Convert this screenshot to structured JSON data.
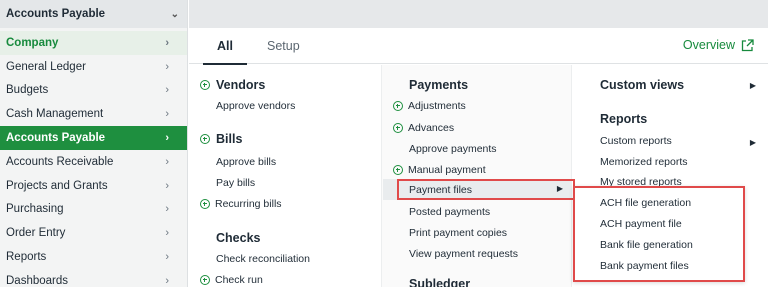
{
  "sidebar": {
    "header": "Accounts Payable",
    "items": [
      {
        "label": "Company"
      },
      {
        "label": "General Ledger"
      },
      {
        "label": "Budgets"
      },
      {
        "label": "Cash Management"
      },
      {
        "label": "Accounts Payable"
      },
      {
        "label": "Accounts Receivable"
      },
      {
        "label": "Projects and Grants"
      },
      {
        "label": "Purchasing"
      },
      {
        "label": "Order Entry"
      },
      {
        "label": "Reports"
      },
      {
        "label": "Dashboards"
      }
    ]
  },
  "tabs": {
    "all": "All",
    "setup": "Setup"
  },
  "overview": "Overview",
  "col1": {
    "vendors": "Vendors",
    "approve_vendors": "Approve vendors",
    "bills": "Bills",
    "approve_bills": "Approve bills",
    "pay_bills": "Pay bills",
    "recurring_bills": "Recurring bills",
    "checks": "Checks",
    "check_reconciliation": "Check reconciliation",
    "check_run": "Check run"
  },
  "col2": {
    "payments": "Payments",
    "adjustments": "Adjustments",
    "advances": "Advances",
    "approve_payments": "Approve payments",
    "manual_payment": "Manual payment",
    "payment_files": "Payment files",
    "posted_payments": "Posted payments",
    "print_payment_copies": "Print payment copies",
    "view_payment_requests": "View payment requests",
    "subledger": "Subledger"
  },
  "col3": {
    "custom_views": "Custom views",
    "reports": "Reports",
    "custom_reports": "Custom reports",
    "memorized_reports": "Memorized reports",
    "my_stored_reports": "My stored reports"
  },
  "submenu": {
    "items": [
      "ACH file generation",
      "ACH payment file",
      "Bank file generation",
      "Bank payment files"
    ]
  },
  "colors": {
    "accent": "#1e8f3f",
    "highlight_box": "#e04a4a"
  }
}
